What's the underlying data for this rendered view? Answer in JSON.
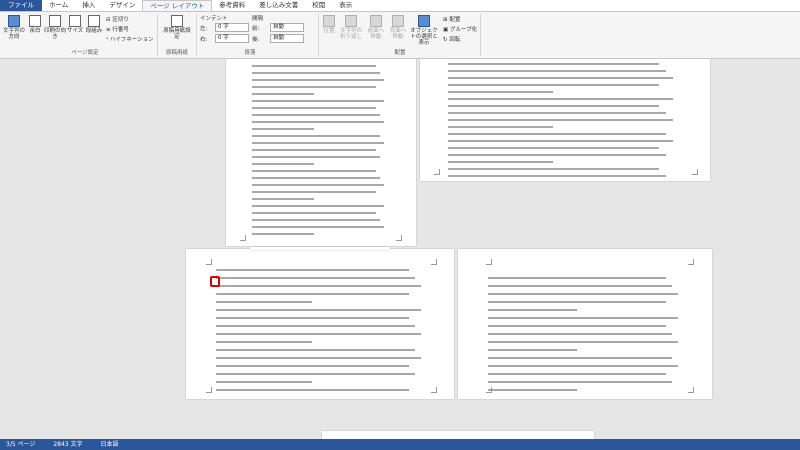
{
  "tabs": {
    "file": "ファイル",
    "home": "ホーム",
    "insert": "挿入",
    "design": "デザイン",
    "layout": "ページ レイアウト",
    "references": "参考資料",
    "mailings": "差し込み文書",
    "review": "校閲",
    "view": "表示"
  },
  "ribbon": {
    "text_direction": "文字列の方向",
    "margins": "余白",
    "orientation": "印刷の向き",
    "size": "サイズ",
    "columns": "段組み",
    "breaks": "区切り",
    "line_numbers": "行番号",
    "hyphenation": "ハイフネーション",
    "page_setup_group": "ページ設定",
    "manuscript_setup": "原稿用紙設定",
    "manuscript_group": "原稿用紙",
    "indent_label": "インデント",
    "left_label": "左:",
    "right_label": "右:",
    "indent_left": "0 字",
    "indent_right": "0 字",
    "spacing_label": "間隔",
    "before_label": "前:",
    "after_label": "後:",
    "spacing_before": "自動",
    "spacing_after": "自動",
    "paragraph_group": "段落",
    "position": "位置",
    "wrap_text": "文字列の折り返し",
    "bring_forward": "前面へ移動",
    "send_backward": "背面へ移動",
    "selection_pane": "オブジェクトの選択と表示",
    "align": "配置",
    "group": "グループ化",
    "rotate": "回転",
    "arrange_group": "配置"
  },
  "status": {
    "page": "3/5 ページ",
    "words": "2843 文字",
    "language": "日本語"
  }
}
